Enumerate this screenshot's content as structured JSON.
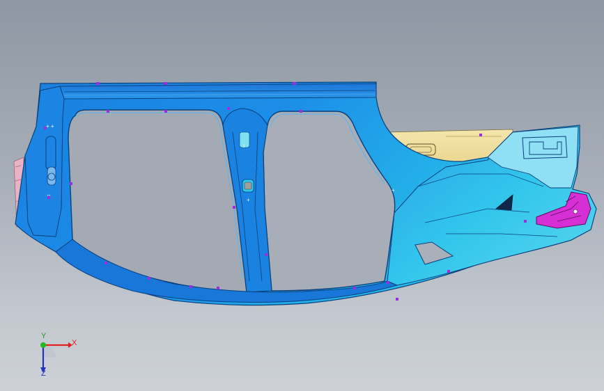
{
  "viewport": {
    "background_top": "#8e97a3",
    "background_bottom": "#cdd1d7"
  },
  "model": {
    "name": "body-side-panel",
    "colors": {
      "main_blue": "#1a8fe6",
      "dark_blue": "#0c5fb8",
      "cyan": "#2ad4f2",
      "light_cyan": "#8fe4f6",
      "rear_panel_cream": "#f0e2a6",
      "bracket_magenta": "#d62ad8",
      "front_hinge_pink": "#e8b0c8",
      "marker_purple": "#9a2ee0"
    }
  },
  "triad": {
    "x_label": "X",
    "y_label": "Y",
    "z_label": "Z",
    "x_color": "#e02020",
    "y_color": "#1a9a1a",
    "z_color": "#2030c0"
  }
}
